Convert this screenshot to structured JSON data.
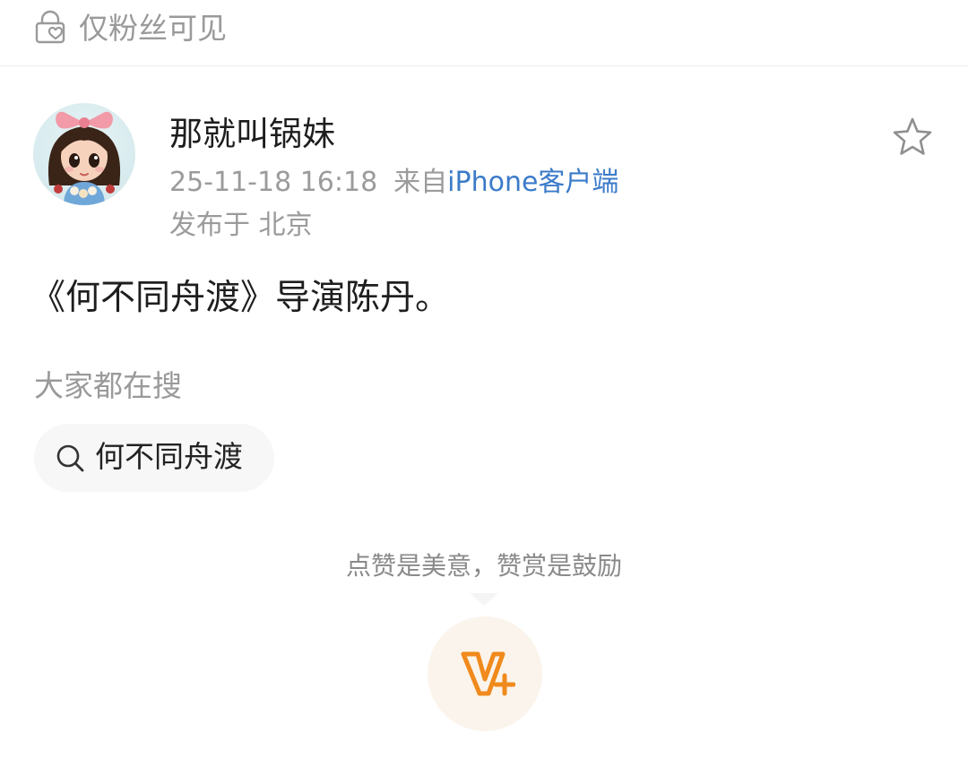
{
  "visibility": {
    "label": "仅粉丝可见",
    "icon": "lock-heart-icon"
  },
  "author": {
    "name": "那就叫锅妹",
    "avatar": "avatar",
    "timestamp": "25-11-18 16:18",
    "source_prefix": "来自",
    "source": "iPhone客户端",
    "location": "发布于 北京"
  },
  "favorite": {
    "icon": "star-icon"
  },
  "post": {
    "text": "《何不同舟渡》导演陈丹。"
  },
  "search": {
    "heading": "大家都在搜",
    "chip_label": "何不同舟渡",
    "icon": "search-icon"
  },
  "reward": {
    "hint": "点赞是美意，赞赏是鼓励",
    "icon": "v-plus-icon"
  },
  "colors": {
    "link": "#3b7bc9",
    "reward_accent": "#f08a1c",
    "muted_text": "#9a9a9a"
  }
}
